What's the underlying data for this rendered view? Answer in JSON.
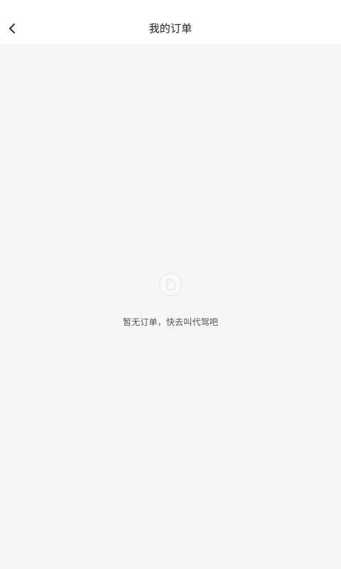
{
  "header": {
    "title": "我的订单",
    "back_icon": "chevron-left-icon"
  },
  "empty_state": {
    "icon": "document-icon",
    "message": "暂无订单，快去叫代驾吧"
  },
  "colors": {
    "background": "#f7f7f7",
    "header_background": "#ffffff",
    "title_text": "#222222",
    "message_text": "#555555",
    "icon_border": "#e6e6e6"
  }
}
